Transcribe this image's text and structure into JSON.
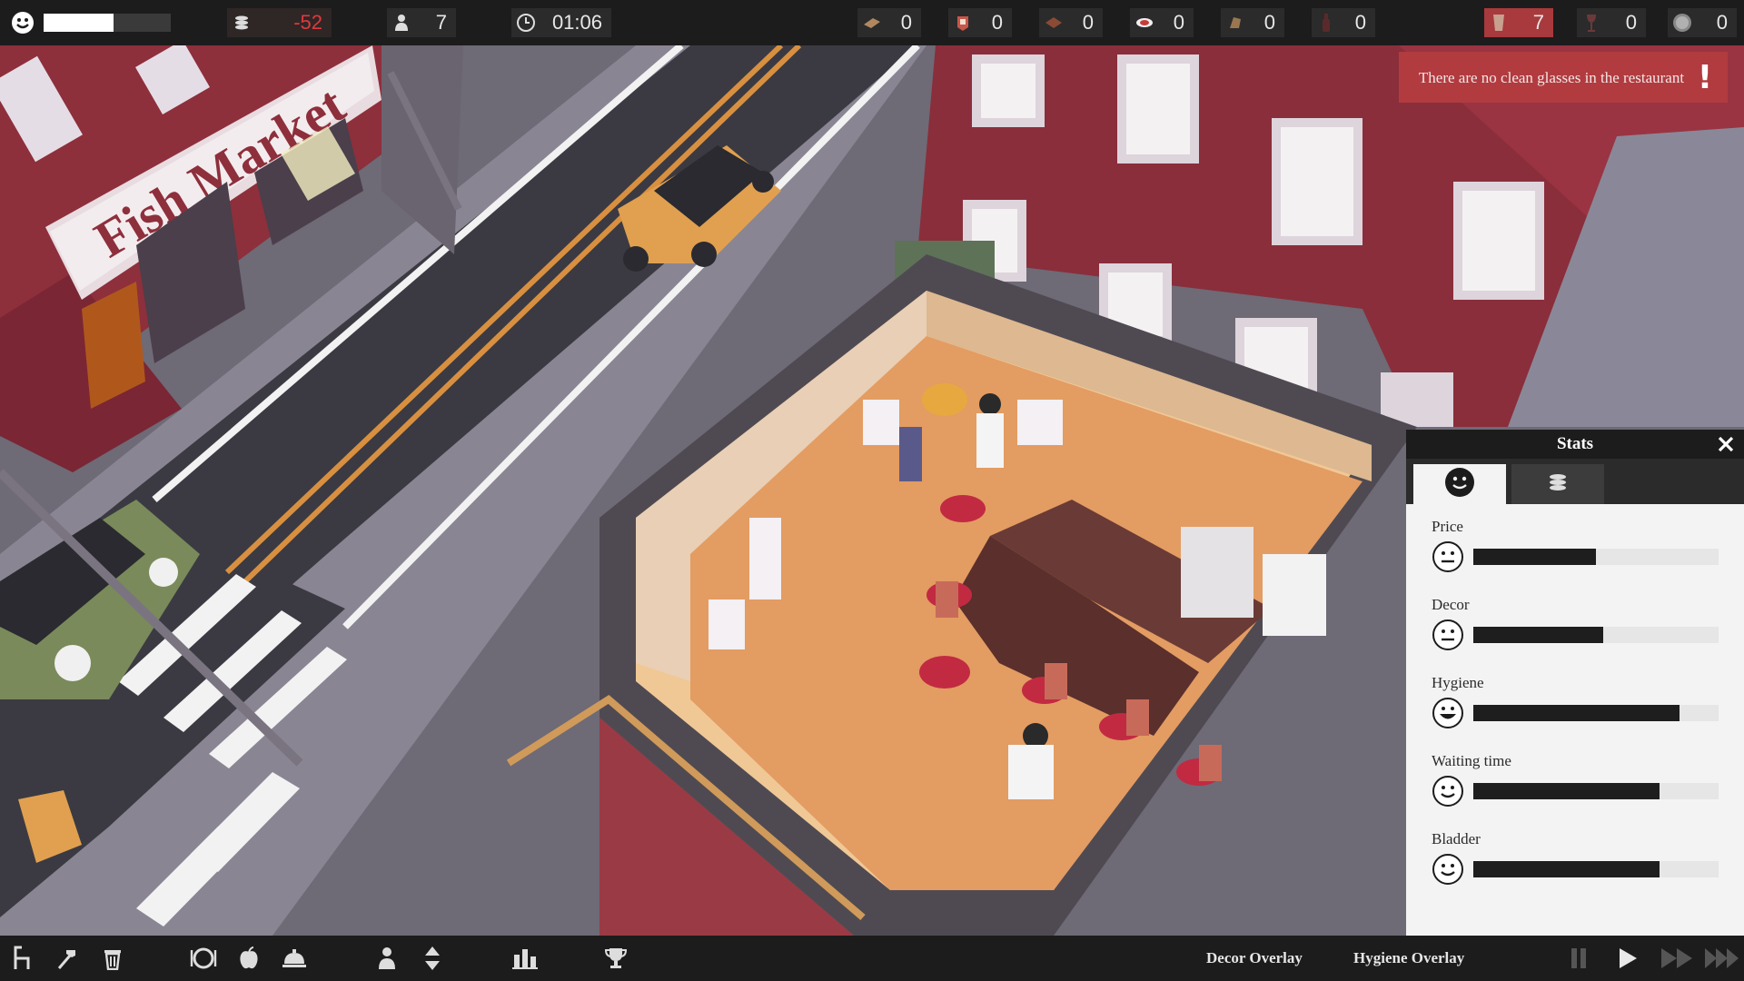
{
  "topbar": {
    "happiness": {
      "icon": "smiley-icon",
      "level": 0.55
    },
    "money": {
      "icon": "coin-stack-icon",
      "value": "-52"
    },
    "customers": {
      "icon": "person-icon",
      "value": "7"
    },
    "time": {
      "icon": "clock-icon",
      "value": "01:06"
    },
    "resources": [
      {
        "icon": "bread-icon",
        "value": "0"
      },
      {
        "icon": "cheese-icon",
        "value": "0"
      },
      {
        "icon": "meat-icon",
        "value": "0"
      },
      {
        "icon": "fish-icon",
        "value": "0"
      },
      {
        "icon": "chicken-icon",
        "value": "0"
      },
      {
        "icon": "bottle-icon",
        "value": "0"
      }
    ],
    "dirty_glasses": {
      "icon": "glass-icon",
      "value": "7"
    },
    "wine_glasses": {
      "icon": "wine-glass-icon",
      "value": "0"
    },
    "plates": {
      "icon": "plate-icon",
      "value": "0"
    }
  },
  "notification": {
    "text": "There are no clean glasses in the restaurant",
    "mark": "!"
  },
  "scene": {
    "sign_text": "Fish Market"
  },
  "stats_panel": {
    "title": "Stats",
    "tabs": [
      {
        "icon": "smiley-icon",
        "active": true
      },
      {
        "icon": "coin-stack-icon",
        "active": false
      }
    ],
    "rows": [
      {
        "label": "Price",
        "face": "neutral",
        "level": 0.5
      },
      {
        "label": "Decor",
        "face": "neutral",
        "level": 0.53
      },
      {
        "label": "Hygiene",
        "face": "happy",
        "level": 0.84
      },
      {
        "label": "Waiting time",
        "face": "smile",
        "level": 0.76
      },
      {
        "label": "Bladder",
        "face": "smile",
        "level": 0.76
      }
    ]
  },
  "bottombar": {
    "tools": [
      "chair-icon",
      "hammer-icon",
      "trash-icon",
      "plate-dome-icon",
      "apple-icon",
      "service-bell-icon",
      "staff-icon",
      "move-vertical-icon",
      "bar-chart-icon",
      "trophy-icon"
    ],
    "decor_overlay": "Decor Overlay",
    "hygiene_overlay": "Hygiene Overlay",
    "speed": [
      "pause-icon",
      "play-icon",
      "fast-forward-icon",
      "fastest-forward-icon"
    ]
  }
}
